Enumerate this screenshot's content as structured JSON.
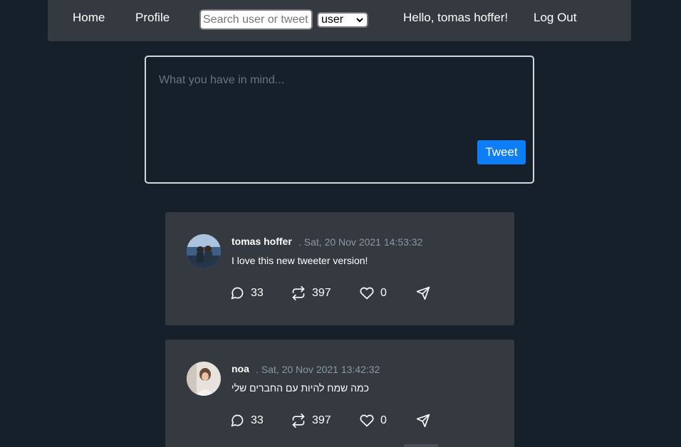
{
  "nav": {
    "home": "Home",
    "profile": "Profile",
    "search_placeholder": "Search user or tweet",
    "search_type": "user",
    "greeting": "Hello, tomas hoffer!",
    "logout": "Log Out"
  },
  "compose": {
    "placeholder": "What you have in mind...",
    "button": "Tweet"
  },
  "tweets": [
    {
      "author": "tomas hoffer",
      "date": ". Sat, 20 Nov 2021 14:53:32",
      "text": "I love this new tweeter version!",
      "comments": "33",
      "retweets": "397",
      "likes": "0"
    },
    {
      "author": "noa",
      "date": ". Sat, 20 Nov 2021 13:42:32",
      "text": "כמה שמח להיות עם החברים שלי",
      "comments": "33",
      "retweets": "397",
      "likes": "0"
    }
  ],
  "colors": {
    "background": "#15202b",
    "navbar": "#343a40",
    "card": "#343a40",
    "accent": "#0d7ef8",
    "date": "#8b98a5"
  },
  "icons": [
    "comment-icon",
    "retweet-icon",
    "heart-icon",
    "share-icon",
    "chevron-down-icon"
  ]
}
